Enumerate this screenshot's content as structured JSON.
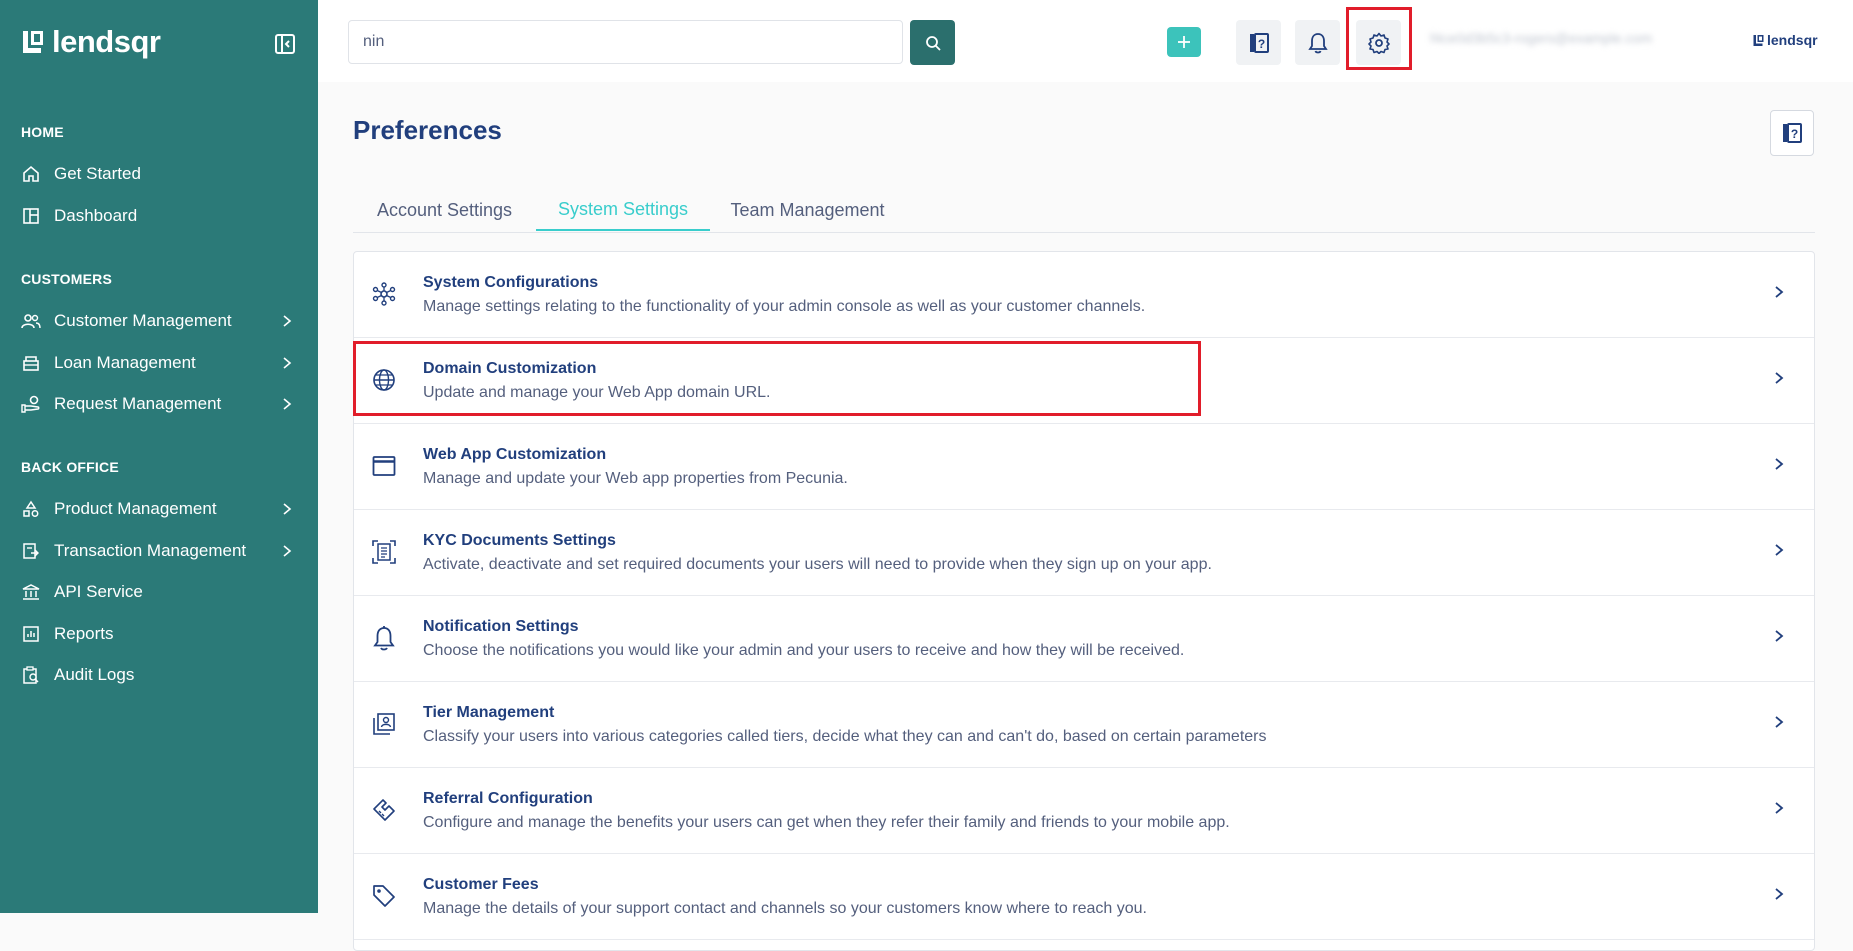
{
  "sidebar": {
    "brand": "lendsqr",
    "sections": [
      {
        "title": "HOME",
        "items": [
          {
            "label": "Get Started",
            "icon": "home-icon",
            "chevron": false
          },
          {
            "label": "Dashboard",
            "icon": "dashboard-icon",
            "chevron": false
          }
        ]
      },
      {
        "title": "CUSTOMERS",
        "items": [
          {
            "label": "Customer Management",
            "icon": "users-icon",
            "chevron": true
          },
          {
            "label": "Loan Management",
            "icon": "loan-icon",
            "chevron": true
          },
          {
            "label": "Request Management",
            "icon": "request-icon",
            "chevron": true
          }
        ]
      },
      {
        "title": "BACK OFFICE",
        "items": [
          {
            "label": "Product Management",
            "icon": "product-icon",
            "chevron": true
          },
          {
            "label": "Transaction Management",
            "icon": "transaction-icon",
            "chevron": true
          },
          {
            "label": "API Service",
            "icon": "bank-icon",
            "chevron": false
          },
          {
            "label": "Reports",
            "icon": "reports-icon",
            "chevron": false
          },
          {
            "label": "Audit Logs",
            "icon": "audit-icon",
            "chevron": false
          }
        ]
      }
    ]
  },
  "topbar": {
    "search_value": "nin",
    "account_email": "f4ce0d3b5c3-rogers@example.com",
    "logo_text": "lendsqr"
  },
  "main": {
    "title": "Preferences",
    "tabs": [
      {
        "label": "Account Settings",
        "active": false
      },
      {
        "label": "System Settings",
        "active": true
      },
      {
        "label": "Team Management",
        "active": false
      }
    ],
    "settings": [
      {
        "title": "System Configurations",
        "desc": "Manage settings relating to the functionality of your admin console as well as your customer channels.",
        "icon": "network-icon"
      },
      {
        "title": "Domain Customization",
        "desc": "Update and manage your Web App domain URL.",
        "icon": "globe-icon"
      },
      {
        "title": "Web App Customization",
        "desc": "Manage and update your Web app properties from Pecunia.",
        "icon": "window-icon"
      },
      {
        "title": "KYC Documents Settings",
        "desc": "Activate, deactivate and set required documents your users will need to provide when they sign up on your app.",
        "icon": "document-scan-icon"
      },
      {
        "title": "Notification Settings",
        "desc": "Choose the notifications you would like your admin and your users to receive and how they will be received.",
        "icon": "bell-icon"
      },
      {
        "title": "Tier Management",
        "desc": "Classify your users into various categories called tiers, decide what they can and can't do, based on certain parameters",
        "icon": "tier-icon"
      },
      {
        "title": "Referral Configuration",
        "desc": "Configure and manage the benefits your users can get when they refer their family and friends to your mobile app.",
        "icon": "handshake-icon"
      },
      {
        "title": "Customer Fees",
        "desc": "Manage the details of your support contact and channels so your customers know where to reach you.",
        "icon": "tag-icon"
      }
    ]
  },
  "colors": {
    "sidebar": "#2b7a78",
    "accent": "#39cdcc",
    "primary_text": "#213f7d",
    "highlight": "#e11d2a"
  }
}
